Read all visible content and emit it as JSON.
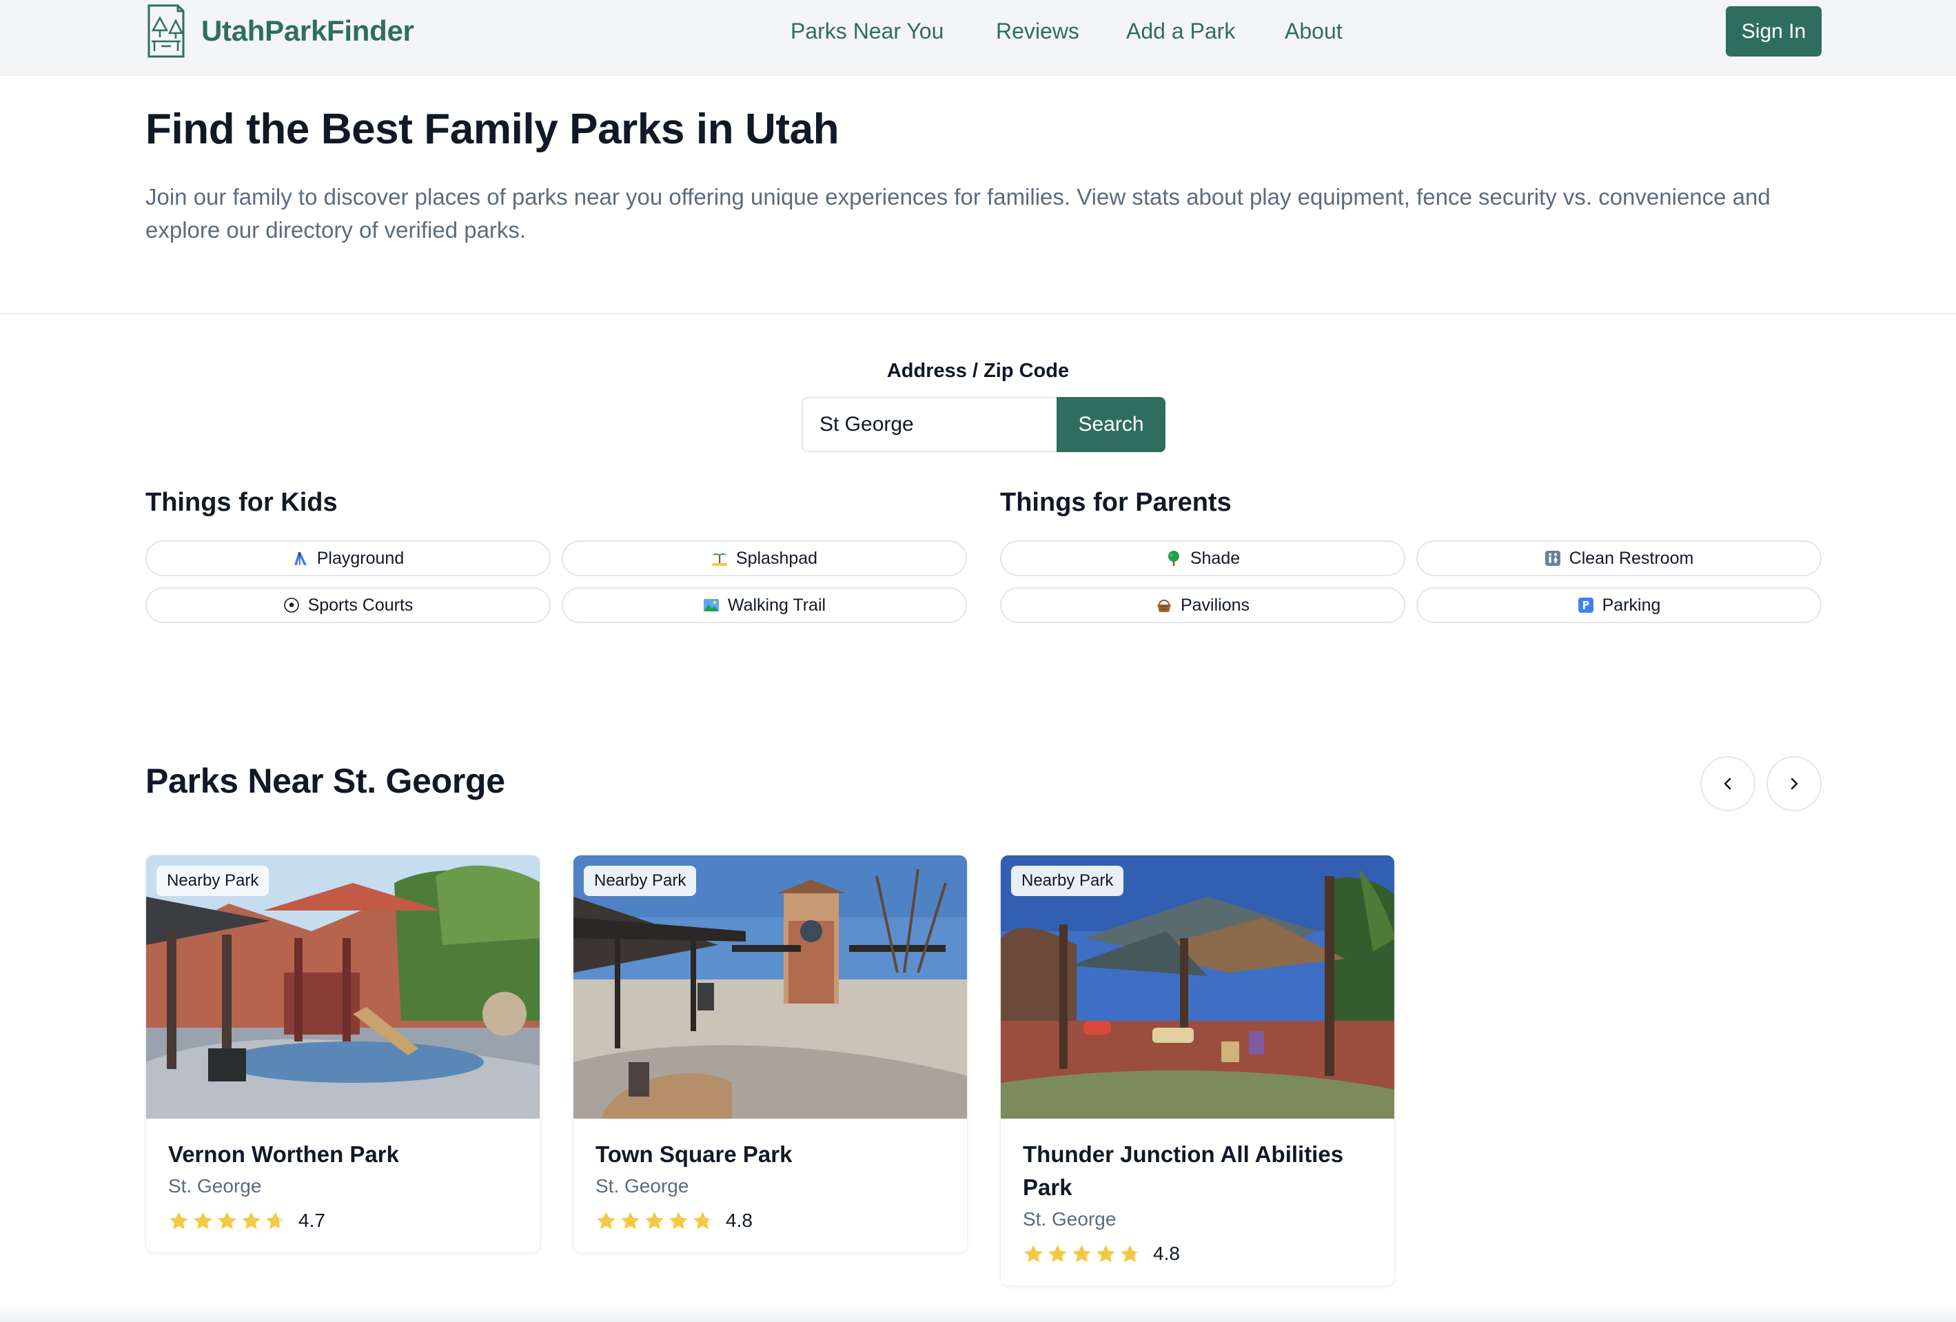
{
  "header": {
    "brand": "UtahParkFinder",
    "nav": [
      "Parks Near You",
      "Reviews",
      "Add a Park",
      "About"
    ],
    "sign_in": "Sign In"
  },
  "hero": {
    "title": "Find the Best Family Parks in Utah",
    "text": "Join our family to discover places of parks near you offering unique experiences for families. View stats about play equipment, fence security vs. convenience and explore our directory of verified parks."
  },
  "search": {
    "label": "Address / Zip Code",
    "value": "St George",
    "button": "Search"
  },
  "filters": {
    "kids": {
      "title": "Things for Kids",
      "items": [
        {
          "label": "Playground",
          "icon": "slide-icon"
        },
        {
          "label": "Splashpad",
          "icon": "beach-icon"
        },
        {
          "label": "Sports Courts",
          "icon": "soccer-ball-icon"
        },
        {
          "label": "Walking Trail",
          "icon": "landscape-icon"
        }
      ]
    },
    "parents": {
      "title": "Things for Parents",
      "items": [
        {
          "label": "Shade",
          "icon": "tree-icon"
        },
        {
          "label": "Clean Restroom",
          "icon": "restroom-icon"
        },
        {
          "label": "Pavilions",
          "icon": "basket-icon"
        },
        {
          "label": "Parking",
          "icon": "parking-icon"
        }
      ]
    }
  },
  "nearby": {
    "title": "Parks Near St. George",
    "badge": "Nearby Park",
    "parks": [
      {
        "name": "Vernon Worthen Park",
        "city": "St. George",
        "rating": 4.7,
        "rating_label": "4.7"
      },
      {
        "name": "Town Square Park",
        "city": "St. George",
        "rating": 4.8,
        "rating_label": "4.8"
      },
      {
        "name": "Thunder Junction All Abilities Park",
        "city": "St. George",
        "rating": 4.8,
        "rating_label": "4.8"
      }
    ]
  },
  "colors": {
    "brand": "#2f6e5e",
    "muted_text": "#5b6b7f",
    "star": "#f5c842",
    "star_empty": "#e5e7eb"
  }
}
